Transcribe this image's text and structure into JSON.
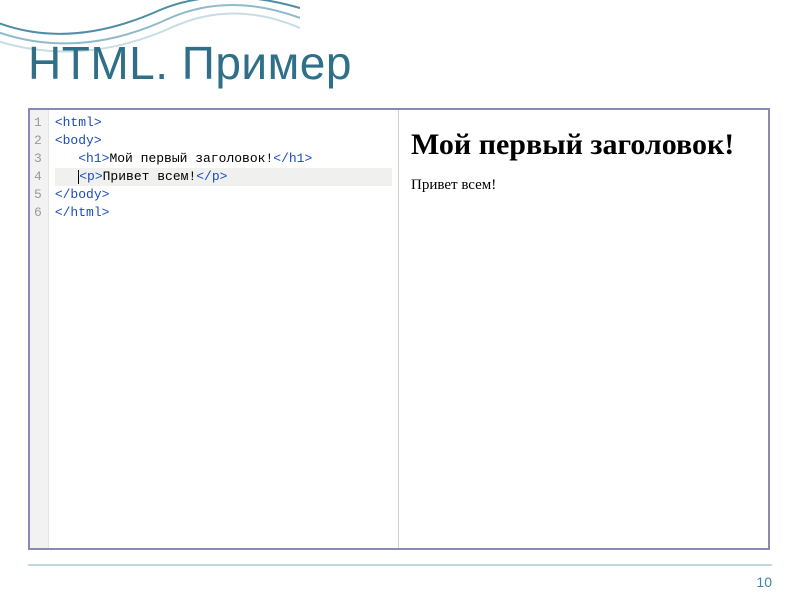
{
  "title": "HTML. Пример",
  "code": {
    "lines": [
      {
        "n": 1,
        "pre": "",
        "open": "<html>",
        "text": "",
        "close": "",
        "hl": false,
        "cursor": false
      },
      {
        "n": 2,
        "pre": "",
        "open": "<body>",
        "text": "",
        "close": "",
        "hl": false,
        "cursor": false
      },
      {
        "n": 3,
        "pre": "   ",
        "open": "<h1>",
        "text": "Мой первый заголовок!",
        "close": "</h1>",
        "hl": false,
        "cursor": false
      },
      {
        "n": 4,
        "pre": "   ",
        "open": "<p>",
        "text": "Привет всем!",
        "close": "</p>",
        "hl": true,
        "cursor": true
      },
      {
        "n": 5,
        "pre": "",
        "open": "</body>",
        "text": "",
        "close": "",
        "hl": false,
        "cursor": false
      },
      {
        "n": 6,
        "pre": "",
        "open": "</html>",
        "text": "",
        "close": "",
        "hl": false,
        "cursor": false
      }
    ]
  },
  "rendered": {
    "heading": "Мой первый заголовок!",
    "paragraph": "Привет всем!"
  },
  "page_number": "10"
}
